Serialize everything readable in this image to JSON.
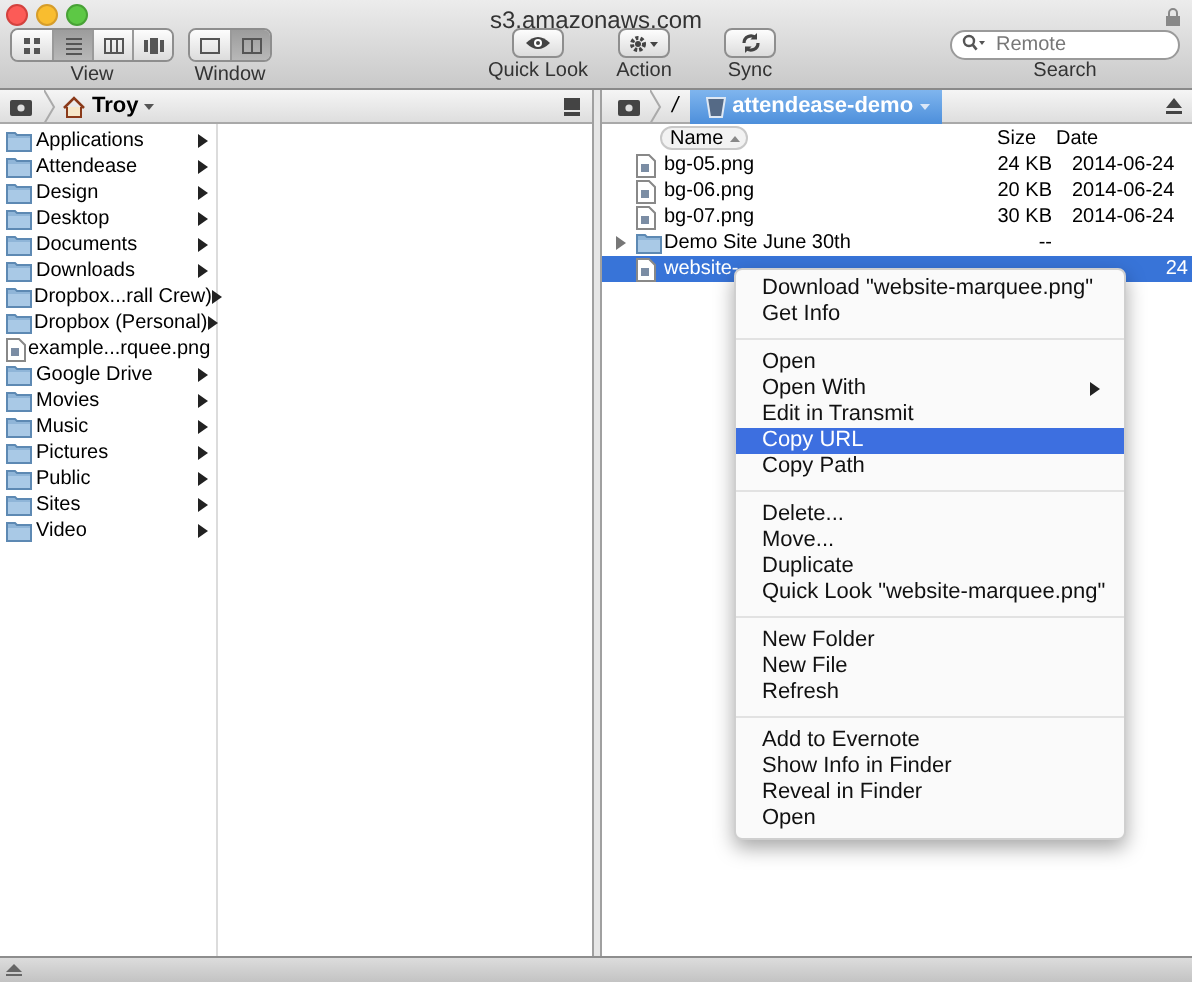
{
  "window": {
    "title": "s3.amazonaws.com",
    "locked": true
  },
  "toolbar": {
    "view": {
      "label": "View",
      "modes": [
        {
          "kind": "icons",
          "selected": false
        },
        {
          "kind": "list",
          "selected": true
        },
        {
          "kind": "columns",
          "selected": false
        },
        {
          "kind": "coverflow",
          "selected": false
        }
      ]
    },
    "window_mode": {
      "label": "Window",
      "modes": [
        {
          "kind": "single",
          "selected": false
        },
        {
          "kind": "dual",
          "selected": true
        }
      ]
    },
    "buttons": [
      {
        "kind": "quicklook",
        "label": "Quick Look"
      },
      {
        "kind": "action",
        "label": "Action"
      },
      {
        "kind": "sync",
        "label": "Sync"
      }
    ],
    "search": {
      "placeholder": "Remote",
      "label": "Search"
    }
  },
  "left_pane": {
    "path": [
      {
        "kind": "home",
        "label": "Troy"
      }
    ],
    "items": [
      {
        "name": "Applications",
        "kind": "folder",
        "has_children": true
      },
      {
        "name": "Attendease",
        "kind": "folder",
        "has_children": true
      },
      {
        "name": "Design",
        "kind": "folder",
        "has_children": true
      },
      {
        "name": "Desktop",
        "kind": "folder",
        "has_children": true
      },
      {
        "name": "Documents",
        "kind": "folder",
        "has_children": true
      },
      {
        "name": "Downloads",
        "kind": "folder",
        "has_children": true
      },
      {
        "name": "Dropbox...rall Crew)",
        "kind": "folder",
        "has_children": true
      },
      {
        "name": "Dropbox (Personal)",
        "kind": "folder",
        "has_children": true
      },
      {
        "name": "example...rquee.png",
        "kind": "file",
        "has_children": false
      },
      {
        "name": "Google Drive",
        "kind": "folder",
        "has_children": true
      },
      {
        "name": "Movies",
        "kind": "folder",
        "has_children": true
      },
      {
        "name": "Music",
        "kind": "folder",
        "has_children": true
      },
      {
        "name": "Pictures",
        "kind": "folder",
        "has_children": true
      },
      {
        "name": "Public",
        "kind": "folder",
        "has_children": true
      },
      {
        "name": "Sites",
        "kind": "folder",
        "has_children": true
      },
      {
        "name": "Video",
        "kind": "folder",
        "has_children": true
      }
    ]
  },
  "right_pane": {
    "path": [
      {
        "kind": "root",
        "label": "/"
      },
      {
        "kind": "bucket",
        "label": "attendease-demo",
        "selected": true
      }
    ],
    "columns": [
      "Name",
      "Size",
      "Date"
    ],
    "rows": [
      {
        "kind": "file",
        "name": "bg-05.png",
        "size": "24 KB",
        "date": "2014-06-24",
        "selected": false
      },
      {
        "kind": "file",
        "name": "bg-06.png",
        "size": "20 KB",
        "date": "2014-06-24",
        "selected": false
      },
      {
        "kind": "file",
        "name": "bg-07.png",
        "size": "30 KB",
        "date": "2014-06-24",
        "selected": false
      },
      {
        "kind": "folder",
        "name": "Demo Site June 30th",
        "size": "--",
        "date": "",
        "selected": false
      },
      {
        "kind": "file",
        "name": "website-",
        "size": "",
        "date": "24",
        "selected": true
      }
    ]
  },
  "context_menu": {
    "sections": [
      [
        {
          "label": "Download \"website-marquee.png\"",
          "submenu": false,
          "selected": false
        },
        {
          "label": "Get Info",
          "submenu": false,
          "selected": false
        }
      ],
      [
        {
          "label": "Open",
          "submenu": false,
          "selected": false
        },
        {
          "label": "Open With",
          "submenu": true,
          "selected": false
        },
        {
          "label": "Edit in Transmit",
          "submenu": false,
          "selected": false
        },
        {
          "label": "Copy URL",
          "submenu": false,
          "selected": true
        },
        {
          "label": "Copy Path",
          "submenu": false,
          "selected": false
        }
      ],
      [
        {
          "label": "Delete...",
          "submenu": false,
          "selected": false
        },
        {
          "label": "Move...",
          "submenu": false,
          "selected": false
        },
        {
          "label": "Duplicate",
          "submenu": false,
          "selected": false
        },
        {
          "label": "Quick Look \"website-marquee.png\"",
          "submenu": false,
          "selected": false
        }
      ],
      [
        {
          "label": "New Folder",
          "submenu": false,
          "selected": false
        },
        {
          "label": "New File",
          "submenu": false,
          "selected": false
        },
        {
          "label": "Refresh",
          "submenu": false,
          "selected": false
        }
      ],
      [
        {
          "label": "Add to Evernote",
          "submenu": false,
          "selected": false
        },
        {
          "label": "Show Info in Finder",
          "submenu": false,
          "selected": false
        },
        {
          "label": "Reveal in Finder",
          "submenu": false,
          "selected": false
        },
        {
          "label": "Open",
          "submenu": false,
          "selected": false
        }
      ]
    ]
  }
}
